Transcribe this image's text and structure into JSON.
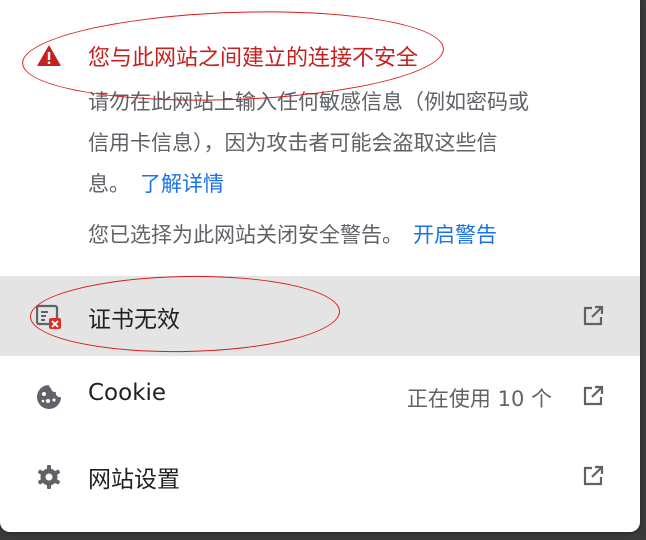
{
  "security": {
    "title": "您与此网站之间建立的连接不安全",
    "body_line1": "请勿在此网站上输入任何敏感信息（例如密码或",
    "body_line2": "信用卡信息），因为攻击者可能会盗取这些信",
    "body_line3": "息。",
    "learn_more": "了解详情",
    "warnings_off_text": "您已选择为此网站关闭安全警告。",
    "enable_warnings": "开启警告"
  },
  "rows": {
    "certificate": {
      "label": "证书无效",
      "icon": "certificate-error-icon"
    },
    "cookie": {
      "label": "Cookie",
      "status": "正在使用 10 个",
      "icon": "cookie-icon"
    },
    "site_settings": {
      "label": "网站设置",
      "icon": "gear-icon"
    }
  },
  "colors": {
    "warning_red": "#c5221f",
    "link_blue": "#1a73e8",
    "highlight_row": "#e4e4e4",
    "annotation_red": "#d81b1b"
  }
}
